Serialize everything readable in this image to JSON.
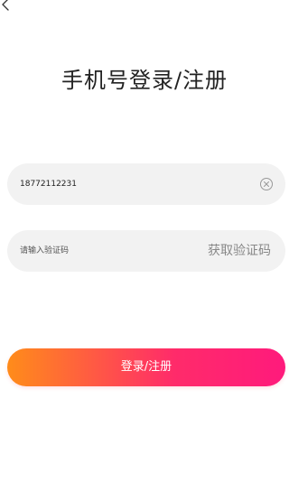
{
  "page": {
    "title": "手机号登录/注册"
  },
  "phone": {
    "value": "18772112231",
    "clear_icon": "clear-circle-x-icon"
  },
  "code": {
    "value": "",
    "placeholder": "请输入验证码",
    "get_code_label": "获取验证码"
  },
  "submit": {
    "label": "登录/注册"
  },
  "colors": {
    "gradient_start": "#ff8c1a",
    "gradient_end": "#ff1a7c",
    "field_bg": "#f2f2f2",
    "muted_text": "#888888"
  },
  "icons": {
    "back": "chevron-left-icon"
  }
}
